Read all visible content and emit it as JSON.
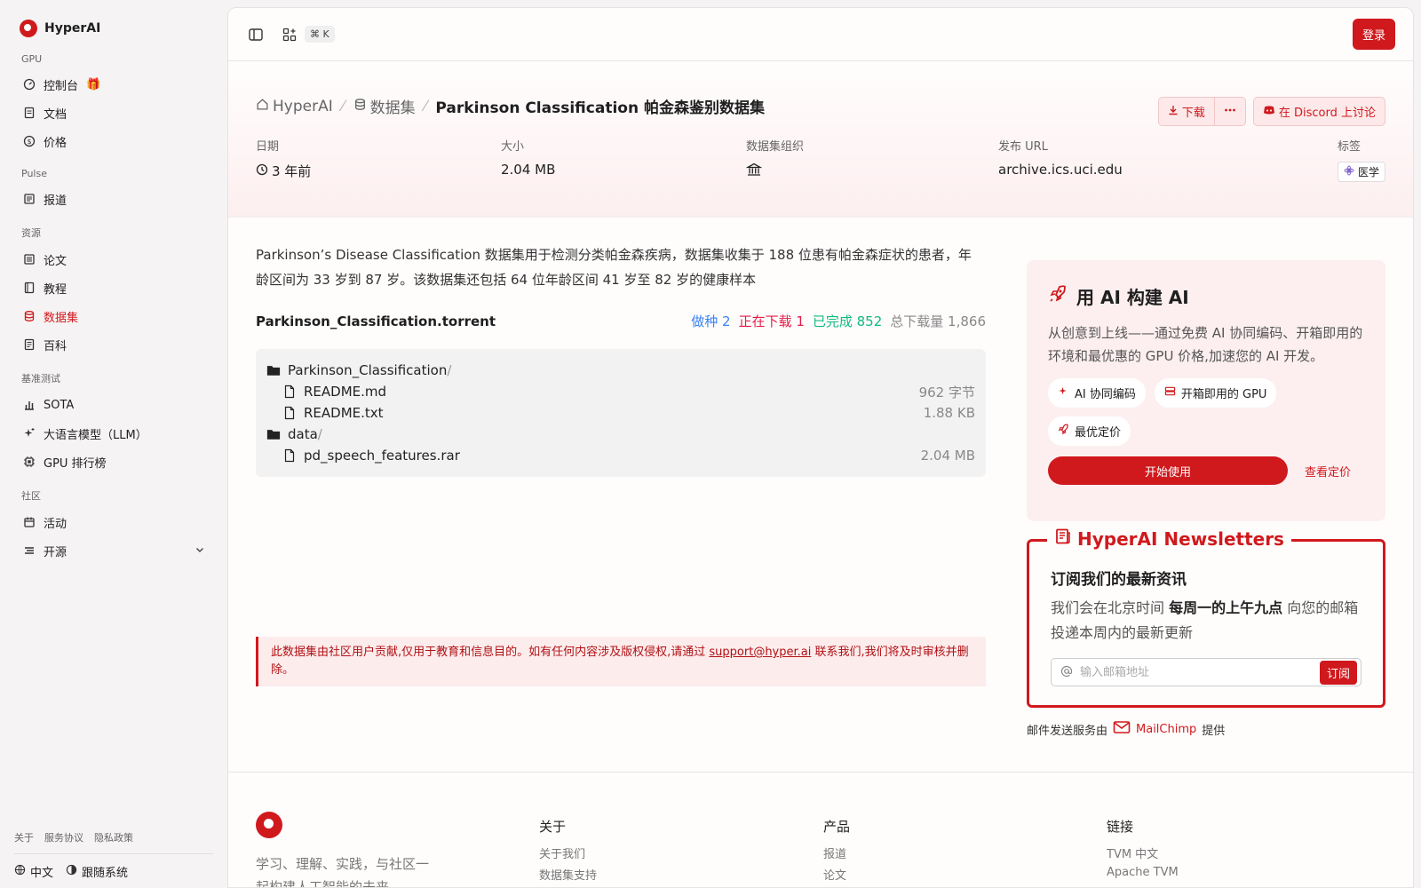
{
  "sidebar": {
    "brand": "HyperAI",
    "sections": {
      "gpu": "GPU",
      "pulse": "Pulse",
      "resources": "资源",
      "benchmark": "基准测试",
      "community": "社区"
    },
    "items": {
      "console": "控制台",
      "docs": "文档",
      "pricing": "价格",
      "news": "报道",
      "papers": "论文",
      "tutorials": "教程",
      "datasets": "数据集",
      "wiki": "百科",
      "sota": "SOTA",
      "llm": "大语言模型（LLM）",
      "gpu_rank": "GPU 排行榜",
      "events": "活动",
      "opensource": "开源"
    },
    "footer_links": [
      "关于",
      "服务协议",
      "隐私政策"
    ],
    "language": "中文",
    "theme": "跟随系统"
  },
  "topbar": {
    "shortcut": "⌘ K",
    "login": "登录"
  },
  "hero": {
    "crumbs": [
      "HyperAI",
      "数据集",
      "Parkinson Classification 帕金森鉴别数据集"
    ],
    "actions": {
      "download": "下载",
      "discord": "在 Discord 上讨论"
    },
    "meta": {
      "date_label": "日期",
      "date_value": "3 年前",
      "size_label": "大小",
      "size_value": "2.04 MB",
      "org_label": "数据集组织",
      "url_label": "发布 URL",
      "url_value": "archive.ics.uci.edu",
      "tags_label": "标签",
      "tag_value": "医学"
    }
  },
  "main": {
    "description": "Parkinson’s Disease Classification 数据集用于检测分类帕金森疾病，数据集收集于 188 位患有帕金森症状的患者，年龄区间为 33 岁到 87 岁。该数据集还包括 64 位年龄区间 41 岁至 82 岁的健康样本",
    "torrent": {
      "name": "Parkinson_Classification.torrent",
      "seeding": "做种 2",
      "downloading": "正在下载 1",
      "completed": "已完成 852",
      "total": "总下载量 1,866"
    },
    "files": [
      {
        "name": "Parkinson_Classification",
        "type": "folder",
        "size": ""
      },
      {
        "name": "README.md",
        "type": "file",
        "size": "962 字节"
      },
      {
        "name": "README.txt",
        "type": "file",
        "size": "1.88 KB"
      },
      {
        "name": "data",
        "type": "folder",
        "size": ""
      },
      {
        "name": "pd_speech_features.rar",
        "type": "file",
        "size": "2.04 MB"
      }
    ],
    "notice_before": "此数据集由社区用户贡献,仅用于教育和信息目的。如有任何内容涉及版权侵权,请通过 ",
    "notice_email": "support@hyper.ai",
    "notice_after": " 联系我们,我们将及时审核并删除。"
  },
  "promo": {
    "title": "用 AI 构建 AI",
    "description": "从创意到上线——通过免费 AI 协同编码、开箱即用的环境和最优惠的 GPU 价格,加速您的 AI 开发。",
    "chips": [
      "AI 协同编码",
      "开箱即用的 GPU",
      "最优定价"
    ],
    "start": "开始使用",
    "pricing_link": "查看定价"
  },
  "newsletter": {
    "legend": "HyperAI Newsletters",
    "title": "订阅我们的最新资讯",
    "desc_before": "我们会在北京时间 ",
    "desc_bold": "每周一的上午九点",
    "desc_after": " 向您的邮箱投递本周内的最新更新",
    "placeholder": "输入邮箱地址",
    "subscribe": "订阅",
    "provider_before": "邮件发送服务由",
    "provider_name": "MailChimp",
    "provider_after": "提供"
  },
  "footer": {
    "tagline": "学习、理解、实践，与社区一起构建人工智能的未来",
    "about_title": "关于",
    "about_links": [
      "关于我们",
      "数据集支持"
    ],
    "product_title": "产品",
    "product_links": [
      "报道",
      "论文"
    ],
    "links_title": "链接",
    "links_links": [
      "TVM 中文",
      "Apache TVM"
    ]
  },
  "colors": {
    "brand": "#d0191d",
    "seeding": "#3b82f6",
    "downloading": "#e11d48",
    "completed": "#10b981",
    "total": "#888888"
  }
}
